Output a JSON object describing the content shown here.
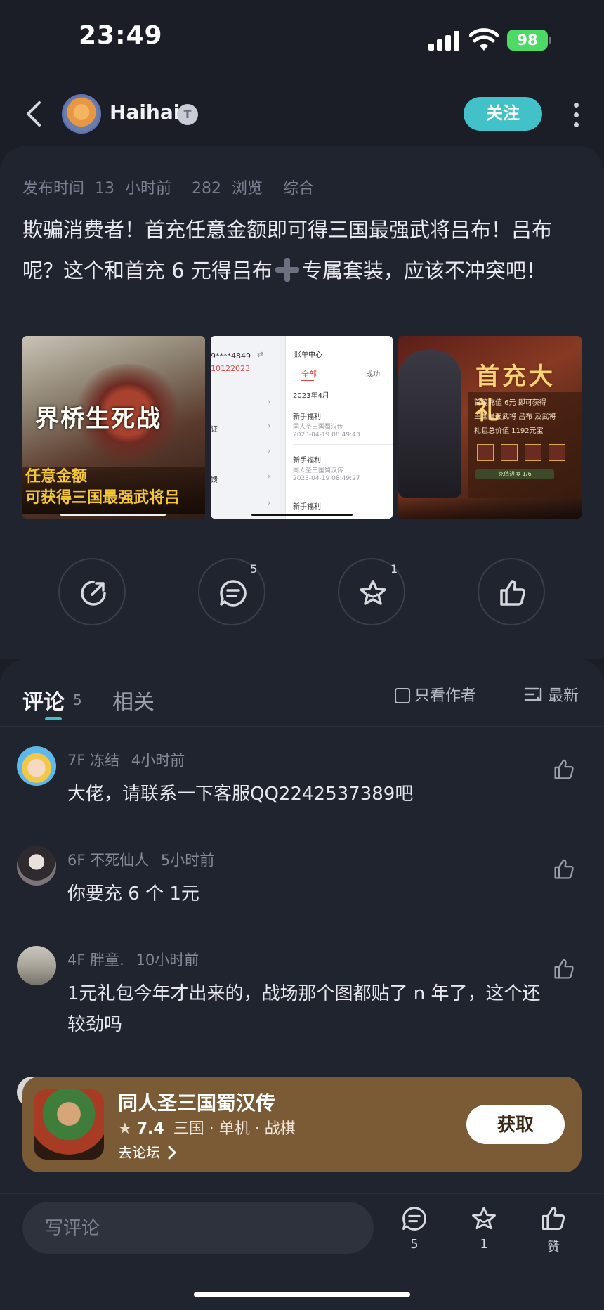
{
  "status_bar": {
    "time": "23:49",
    "battery": "98"
  },
  "header": {
    "username": "Haihai",
    "level_badge": "T",
    "follow_label": "关注"
  },
  "post": {
    "meta_time": "发布时间 13 小时前",
    "meta_views": "282 浏览",
    "meta_category": "综合",
    "body_part1": "欺骗消费者！首充任意金额即可得三国最强武将吕布！吕布呢？这个和首充 6 元得吕布",
    "body_part2": "专属套装，应该不冲突吧！",
    "images": [
      {
        "big_text": "界桥生死战",
        "gold_line1": "任意金额",
        "gold_line2": "可获得三国最强武将吕"
      },
      {
        "account_mask": "9****4849",
        "account_id": "10122023",
        "title": "账单中心",
        "tab_all": "全部",
        "tab_success": "成功",
        "month": "2023年4月",
        "left_items": [
          "证",
          "馈"
        ],
        "records": [
          {
            "name": "新手福利",
            "game": "同人圣三国蜀汉传",
            "time": "2023-04-19 08:49:43"
          },
          {
            "name": "新手福利",
            "game": "同人圣三国蜀汉传",
            "time": "2023-04-19 08:49:27"
          },
          {
            "name": "新手福利"
          }
        ]
      },
      {
        "title": "首充大礼",
        "line1": "首笔充值 6元 即可获得",
        "line2": "三国最强武将 吕布 及武将",
        "line3": "礼包总价值 1192元宝",
        "progress": "充值进度 1/6"
      }
    ]
  },
  "actions": {
    "comment_count": "5",
    "favorite_count": "1"
  },
  "comments_tabs": {
    "comments_label": "评论",
    "comments_count": "5",
    "related_label": "相关",
    "author_only_label": "只看作者",
    "sort_label": "最新"
  },
  "comments": [
    {
      "floor": "7F",
      "user": "冻结",
      "time": "4小时前",
      "text": "大佬，请联系一下客服QQ2242537389吧"
    },
    {
      "floor": "6F",
      "user": "不死仙人",
      "time": "5小时前",
      "text": "你要充 6 个 1元"
    },
    {
      "floor": "4F",
      "user": "胖童.",
      "time": "10小时前",
      "text": "1元礼包今年才出来的，战场那个图都贴了 n 年了，这个还较劲吗"
    }
  ],
  "game_card": {
    "title": "同人圣三国蜀汉传",
    "rating": "7.4",
    "tags": "三国 · 单机 · 战棋",
    "forum_link": "去论坛",
    "get_label": "获取"
  },
  "bottom_bar": {
    "write_placeholder": "写评论",
    "comment_count": "5",
    "favorite_count": "1",
    "like_label": "赞"
  }
}
